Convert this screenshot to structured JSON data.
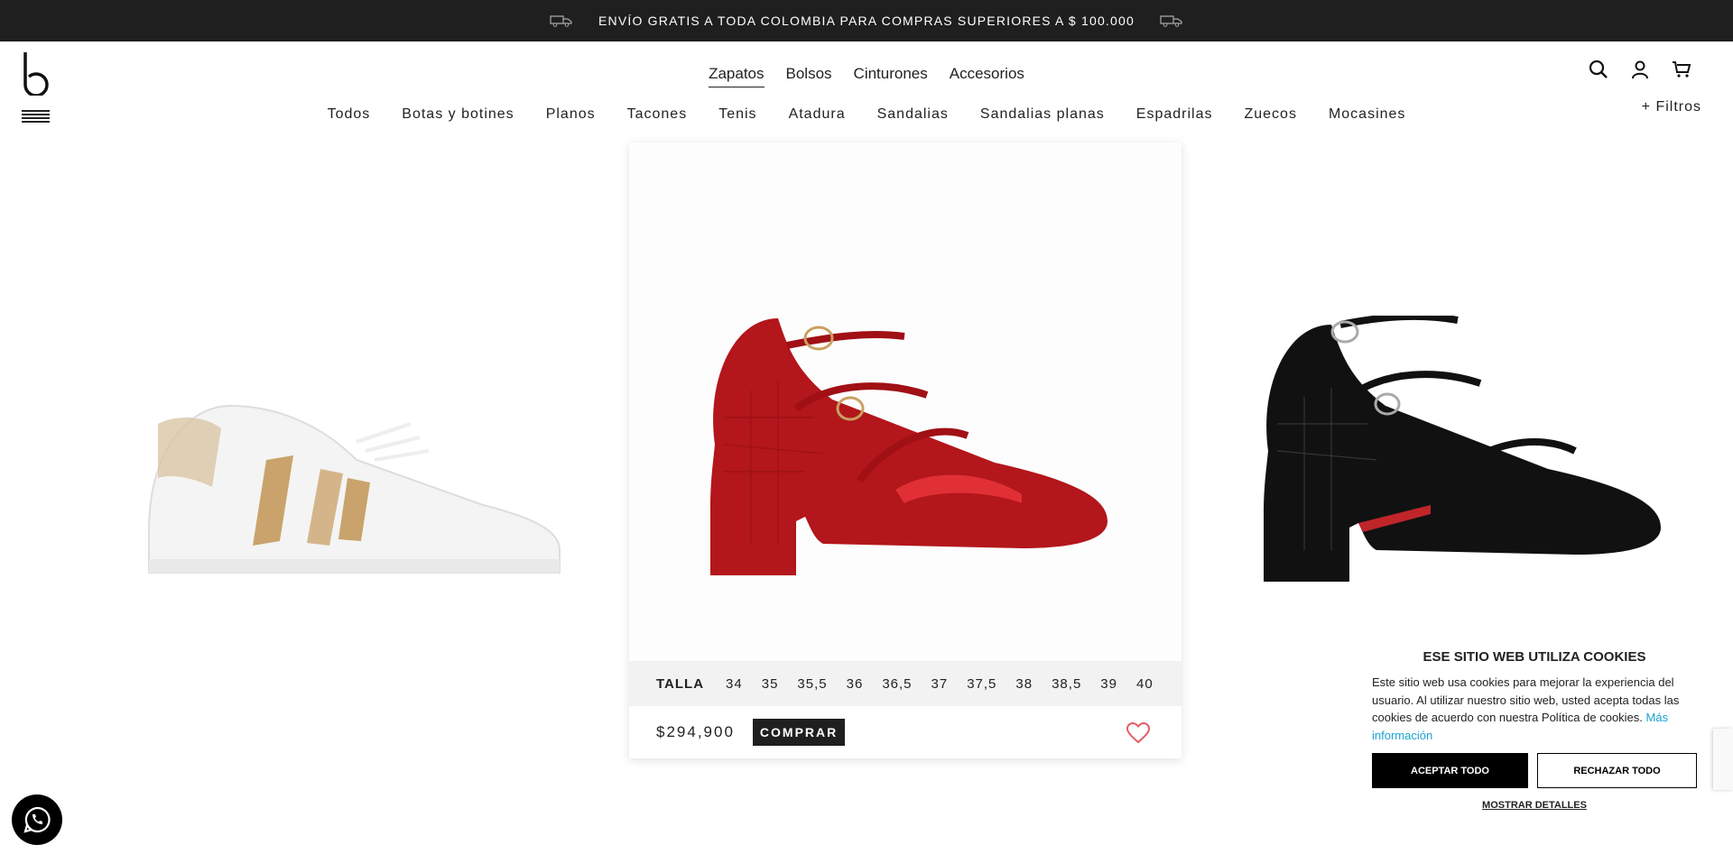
{
  "announcement": {
    "text": "ENVÍO GRATIS A TODA COLOMBIA PARA COMPRAS SUPERIORES A $ 100.000",
    "left_icon": "truck-icon",
    "right_icon": "truck-icon"
  },
  "header": {
    "logo_icon": "brand-logo",
    "menu_icon": "hamburger-icon",
    "main_nav": [
      {
        "label": "Zapatos",
        "active": true
      },
      {
        "label": "Bolsos",
        "active": false
      },
      {
        "label": "Cinturones",
        "active": false
      },
      {
        "label": "Accesorios",
        "active": false
      }
    ],
    "sub_nav": [
      "Todos",
      "Botas y botines",
      "Planos",
      "Tacones",
      "Tenis",
      "Atadura",
      "Sandalias",
      "Sandalias planas",
      "Espadrilas",
      "Zuecos",
      "Mocasines"
    ],
    "icons": [
      "search-icon",
      "user-icon",
      "cart-icon"
    ],
    "filters_label": "+ Filtros"
  },
  "products": [
    {
      "name": "white-sneaker",
      "colors": {
        "main": "#f5f5f5",
        "accent": "#c9a36b"
      }
    },
    {
      "name": "red-heel",
      "colors": {
        "main": "#b3161b"
      },
      "size_label": "TALLA",
      "sizes": [
        "34",
        "35",
        "35,5",
        "36",
        "36,5",
        "37",
        "37,5",
        "38",
        "38,5",
        "39",
        "40"
      ],
      "price": "$294,900",
      "buy_label": "COMPRAR",
      "wishlist_icon": "heart-icon"
    },
    {
      "name": "black-heel",
      "colors": {
        "main": "#111111"
      }
    }
  ],
  "cookie_banner": {
    "title": "ESE SITIO WEB UTILIZA COOKIES",
    "text": "Este sitio web usa cookies para mejorar la experiencia del usuario. Al utilizar nuestro sitio web, usted acepta todas las cookies de acuerdo con nuestra Política de cookies.",
    "more_info": "Más información",
    "accept_label": "ACEPTAR TODO",
    "reject_label": "RECHAZAR TODO",
    "details_label": "MOSTRAR DETALLES"
  },
  "floating": {
    "whatsapp_icon": "whatsapp-icon"
  },
  "colors": {
    "dark": "#1f1f1f",
    "link": "#1aa3d1",
    "heart": "#e35d63",
    "size_bar": "#f2f2f2"
  }
}
